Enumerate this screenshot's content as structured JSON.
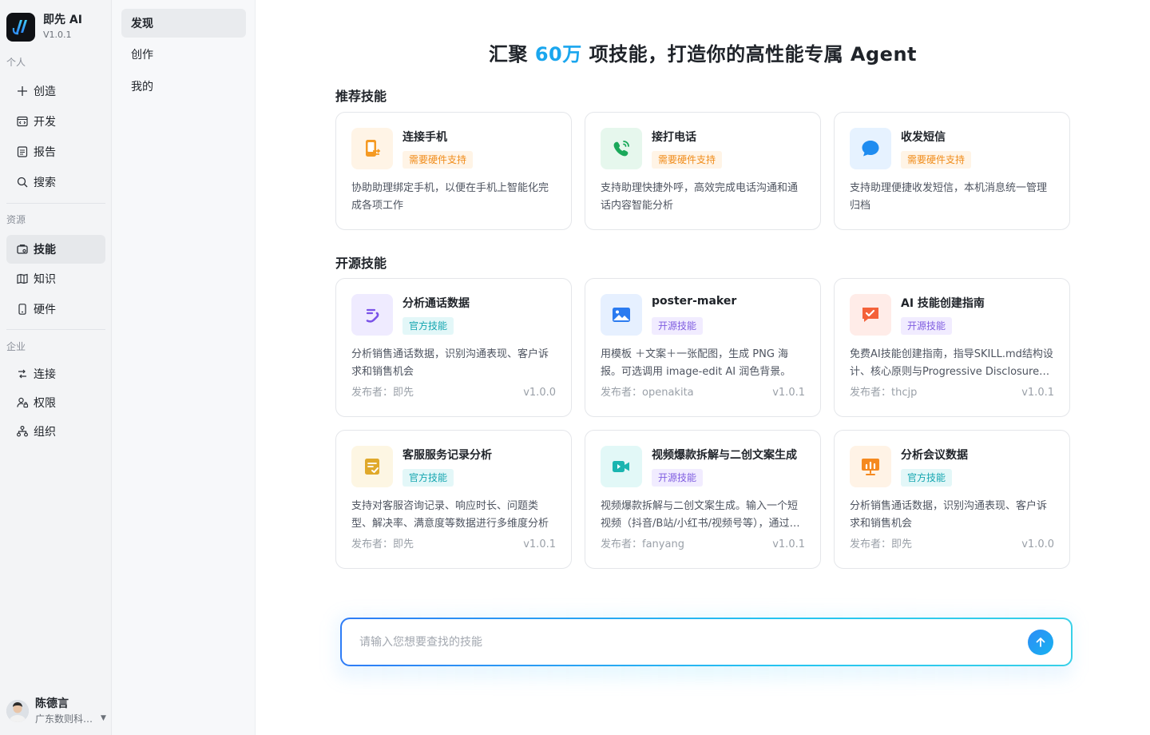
{
  "brand": {
    "name": "即先 AI",
    "version": "V1.0.1"
  },
  "sidebar": {
    "sections": [
      {
        "label": "个人",
        "items": [
          {
            "label": "创造",
            "icon": "plus-icon"
          },
          {
            "label": "开发",
            "icon": "code-window-icon"
          },
          {
            "label": "报告",
            "icon": "document-icon"
          },
          {
            "label": "搜索",
            "icon": "search-icon"
          }
        ]
      },
      {
        "label": "资源",
        "items": [
          {
            "label": "技能",
            "icon": "skill-icon"
          },
          {
            "label": "知识",
            "icon": "book-icon"
          },
          {
            "label": "硬件",
            "icon": "phone-icon"
          }
        ]
      },
      {
        "label": "企业",
        "items": [
          {
            "label": "连接",
            "icon": "connect-icon"
          },
          {
            "label": "权限",
            "icon": "permission-icon"
          },
          {
            "label": "组织",
            "icon": "org-icon"
          }
        ]
      }
    ],
    "active": "技能"
  },
  "user": {
    "name": "陈德言",
    "org": "广东数则科技有限公司"
  },
  "subnav": {
    "items": [
      "发现",
      "创作",
      "我的"
    ],
    "active": "发现"
  },
  "hero": {
    "prefix": "汇聚 ",
    "highlight": "60万",
    "suffix": " 项技能，打造你的高性能专属 Agent",
    "highlight_color": "#1aa6ee"
  },
  "recommended": {
    "title": "推荐技能",
    "cards": [
      {
        "title": "连接手机",
        "tag": "需要硬件支持",
        "desc": "协助助理绑定手机，以便在手机上智能化完成各项工作",
        "icon": "phone-link-icon"
      },
      {
        "title": "接打电话",
        "tag": "需要硬件支持",
        "desc": "支持助理快捷外呼，高效完成电话沟通和通话内容智能分析",
        "icon": "phone-call-icon"
      },
      {
        "title": "收发短信",
        "tag": "需要硬件支持",
        "desc": "支持助理便捷收发短信，本机消息统一管理归档",
        "icon": "message-icon"
      }
    ]
  },
  "opensource": {
    "title": "开源技能",
    "publisher_label": "发布者：",
    "cards": [
      {
        "title": "分析通话数据",
        "tag": "官方技能",
        "desc": "分析销售通话数据，识别沟通表现、客户诉求和销售机会",
        "publisher": "即先",
        "version": "v1.0.0",
        "icon": "call-analysis-icon"
      },
      {
        "title": "poster-maker",
        "tag": "开源技能",
        "desc": "用模板 ＋文案＋一张配图，生成 PNG 海报。可选调用 image-edit AI 润色背景。",
        "publisher": "openakita",
        "version": "v1.0.1",
        "icon": "image-icon"
      },
      {
        "title": "AI 技能创建指南",
        "tag": "开源技能",
        "desc": "免费AI技能创建指南，指导SKILL.md结构设计、核心原则与Progressive Disclosure分层设计方法",
        "publisher": "thcjp",
        "version": "v1.0.1",
        "icon": "chat-check-icon"
      },
      {
        "title": "客服服务记录分析",
        "tag": "官方技能",
        "desc": "支持对客服咨询记录、响应时长、问题类型、解决率、满意度等数据进行多维度分析",
        "publisher": "即先",
        "version": "v1.0.1",
        "icon": "record-check-icon"
      },
      {
        "title": "视频爆款拆解与二创文案生成",
        "tag": "开源技能",
        "desc": "视频爆款拆解与二创文案生成。输入一个短视频（抖音/B站/小红书/视频号等），通过AI分析生成文案",
        "publisher": "fanyang",
        "version": "v1.0.1",
        "icon": "video-icon"
      },
      {
        "title": "分析会议数据",
        "tag": "官方技能",
        "desc": "分析销售通话数据，识别沟通表现、客户诉求和销售机会",
        "publisher": "即先",
        "version": "v1.0.0",
        "icon": "meeting-chart-icon"
      }
    ]
  },
  "search": {
    "placeholder": "请输入您想要查找的技能",
    "button_icon": "arrow-up-icon"
  }
}
